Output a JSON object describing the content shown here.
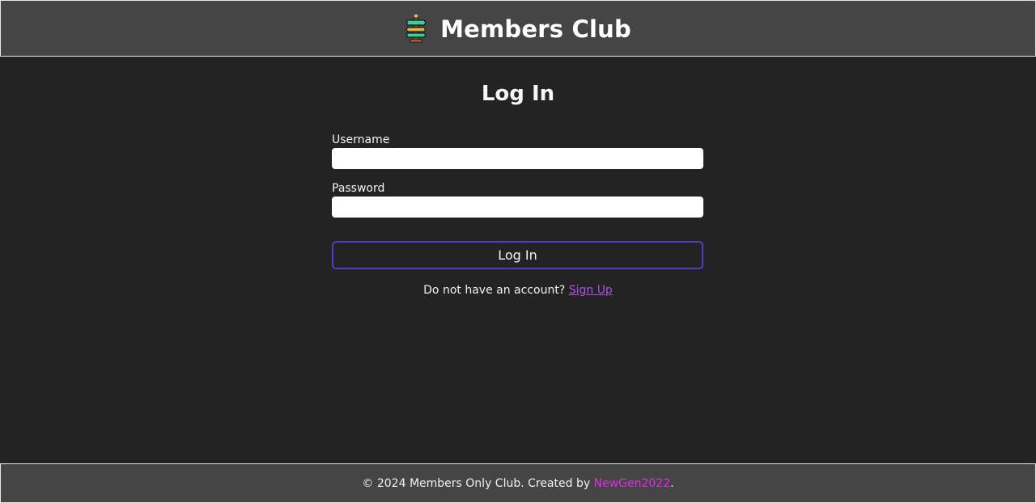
{
  "header": {
    "title": "Members Club",
    "logo_icon": "signpost-icon"
  },
  "login": {
    "heading": "Log In",
    "username_label": "Username",
    "username_value": "",
    "password_label": "Password",
    "password_value": "",
    "submit_label": "Log In",
    "signup_prompt": "Do not have an account?",
    "signup_link": "Sign Up"
  },
  "footer": {
    "copyright": "© 2024 Members Only Club. Created by",
    "author": "NewGen2022",
    "suffix": "."
  },
  "colors": {
    "background": "#232323",
    "bar": "#454545",
    "button_border": "#4b3cc9",
    "signup_link": "#b44ee8",
    "author_link": "#e22ce8"
  }
}
